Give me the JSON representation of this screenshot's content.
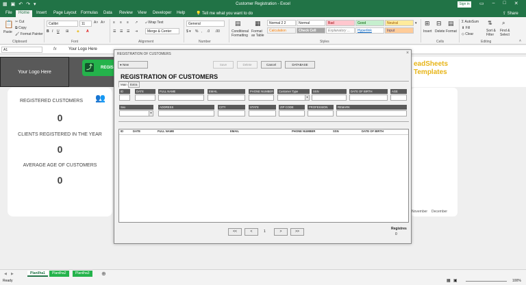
{
  "window": {
    "title": "Customer Registration  -  Excel",
    "signin": "Sign in",
    "share": "Share",
    "tell_me": "Tell me what you want to do"
  },
  "tabs": [
    "File",
    "Home",
    "Insert",
    "Page Layout",
    "Formulas",
    "Data",
    "Review",
    "View",
    "Developer",
    "Help"
  ],
  "ribbon": {
    "clipboard": {
      "paste": "Paste",
      "cut": "Cut",
      "copy": "Copy",
      "format_painter": "Format Painter",
      "group": "Clipboard"
    },
    "font": {
      "name": "Calibri",
      "size": "11",
      "group": "Font"
    },
    "alignment": {
      "wrap": "Wrap Text",
      "merge": "Merge & Center",
      "group": "Alignment"
    },
    "number": {
      "format": "General",
      "group": "Number"
    },
    "styles": {
      "conditional": "Conditional Formatting",
      "format_table": "Format as Table",
      "cells": [
        "Normal 2 2",
        "Normal",
        "Bad",
        "Good",
        "Neutral",
        "Calculation",
        "Check Cell",
        "Explanatory ...",
        "Hyperlink",
        "Input"
      ],
      "group": "Styles"
    },
    "cells": {
      "insert": "Insert",
      "delete": "Delete",
      "format": "Format",
      "group": "Cells"
    },
    "editing": {
      "autosum": "AutoSum",
      "fill": "Fill",
      "clear": "Clear",
      "sort": "Sort & Filter",
      "find": "Find & Select",
      "group": "Editing"
    }
  },
  "formula_bar": {
    "name_box": "A1",
    "fx": "fx",
    "formula": "Your Logo Here"
  },
  "sheet": {
    "logo": "Your Logo Here",
    "green_button": "REGIS",
    "brand_line1": "eadSheets",
    "brand_line2": "Templates",
    "card": {
      "registered_title": "REGISTERED CUSTOMERS",
      "registered_value": "0",
      "year_title": "CLIENTS REGISTERED IN THE YEAR",
      "year_value": "0",
      "age_title": "AVERAGE AGE OF CUSTOMERS",
      "age_value": "0"
    },
    "right_card_months": [
      "November",
      "December"
    ]
  },
  "dialog": {
    "title": "REGISTRATION OF CUSTOMERS",
    "close": "×",
    "buttons": {
      "new": "New",
      "save": "Save",
      "delete": "Delete",
      "cancel": "Cancel",
      "database": "DATABASE"
    },
    "heading": "REGISTRATION OF CUSTOMERS",
    "page_tabs": [
      "Main",
      "Extra"
    ],
    "row1_labels": [
      "ID",
      "DATE",
      "FULL NAME",
      "EMAIL",
      "PHONE NUMBER",
      "Customer Type",
      "SSN",
      "DATE OF BIRTH",
      "AGE"
    ],
    "row2_labels": [
      "Sex",
      "ADDRESS",
      "CITY",
      "STATE",
      "ZIP CODE",
      "PROFESSION",
      "REMARK"
    ],
    "list_headers": [
      "ID",
      "DATE",
      "FULL NAME",
      "EMAIL",
      "PHONE NUMBER",
      "SSN",
      "DATE OF BIRTH"
    ],
    "pager": {
      "first": "<<",
      "prev": "<",
      "page": "1",
      "next": ">",
      "last": ">>"
    },
    "registers_label": "Registres",
    "registers_value": "0"
  },
  "sheet_tabs": [
    "Planilha1",
    "Planilha2",
    "Planilha3"
  ],
  "status": {
    "ready": "Ready",
    "zoom": "100%"
  }
}
